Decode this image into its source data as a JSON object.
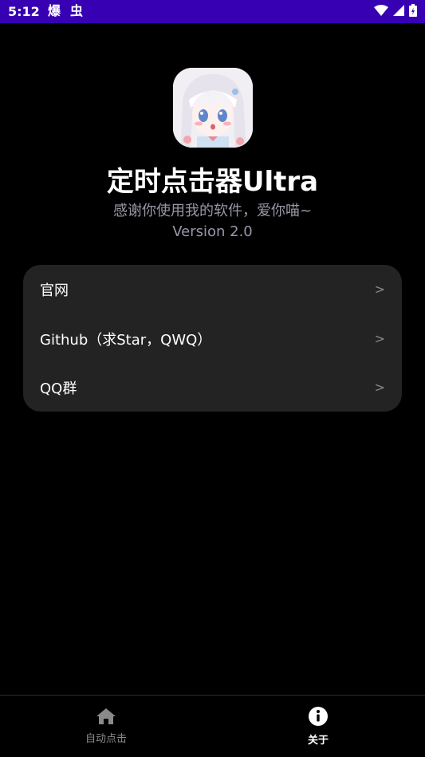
{
  "status_bar": {
    "time": "5:12",
    "notification_icons": [
      "bomb-icon",
      "bug-icon"
    ],
    "system_icons": [
      "wifi-icon",
      "signal-icon",
      "battery-icon"
    ]
  },
  "app": {
    "name": "定时点击器Ultra",
    "tagline": "感谢你使用我的软件，爱你喵~",
    "version": "Version 2.0"
  },
  "links": [
    {
      "label": "官网",
      "arrow": ">"
    },
    {
      "label": "Github（求Star，QWQ）",
      "arrow": ">"
    },
    {
      "label": "QQ群",
      "arrow": ">"
    }
  ],
  "bottom_nav": {
    "items": [
      {
        "label": "自动点击",
        "icon": "home-icon",
        "active": false
      },
      {
        "label": "关于",
        "icon": "info-icon",
        "active": true
      }
    ],
    "active_color": "#ffffff",
    "inactive_color": "#8a8a8a"
  },
  "colors": {
    "status_bar": "#3700b3",
    "background": "#000000",
    "card": "#232323",
    "muted_text": "#9a96a6"
  }
}
